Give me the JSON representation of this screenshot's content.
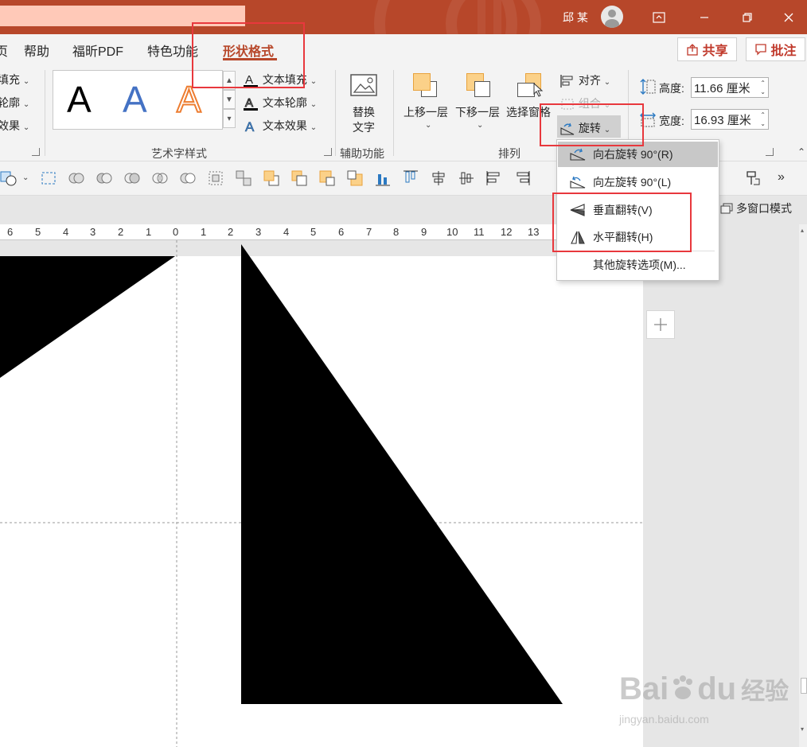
{
  "titlebar": {
    "user_name": "邱 某",
    "buttons": {
      "upload": "⊡",
      "restore": "❐",
      "close": "✕"
    }
  },
  "tabs": [
    {
      "label": "页"
    },
    {
      "label": "帮助"
    },
    {
      "label": "福昕PDF"
    },
    {
      "label": "特色功能"
    },
    {
      "label": "形状格式"
    }
  ],
  "header_buttons": {
    "share": "共享",
    "comment": "批注"
  },
  "ribbon": {
    "shape_styles_left": {
      "fill": "填充",
      "outline": "轮廓",
      "effects": "效果"
    },
    "wordart": {
      "letters": [
        "A",
        "A",
        "A"
      ],
      "text_fill": "文本填充",
      "text_outline": "文本轮廓",
      "text_effects": "文本效果",
      "group_label": "艺术字样式"
    },
    "accessibility": {
      "alt_text_line1": "替换",
      "alt_text_line2": "文字",
      "group_label": "辅助功能"
    },
    "arrange": {
      "bring_forward": "上移一层",
      "send_backward": "下移一层",
      "selection_pane": "选择窗格",
      "align": "对齐",
      "group": "组合",
      "rotate": "旋转",
      "group_label": "排列"
    },
    "size": {
      "height_label": "高度:",
      "height_value": "11.66 厘米",
      "width_label": "宽度:",
      "width_value": "16.93 厘米"
    }
  },
  "multi_window": "多窗口模式",
  "ruler": {
    "labels": [
      "6",
      "5",
      "4",
      "3",
      "2",
      "1",
      "0",
      "1",
      "2",
      "3",
      "4",
      "5",
      "6",
      "7",
      "8",
      "9",
      "10",
      "11",
      "12",
      "13"
    ]
  },
  "rotate_menu": {
    "items": [
      {
        "label": "向右旋转 90°(R)",
        "icon": "rotate-right-icon",
        "highlighted": true
      },
      {
        "label": "向左旋转 90°(L)",
        "icon": "rotate-left-icon",
        "highlighted": false
      },
      {
        "label": "垂直翻转(V)",
        "icon": "flip-vertical-icon",
        "highlighted": false
      },
      {
        "label": "水平翻转(H)",
        "icon": "flip-horizontal-icon",
        "highlighted": false
      },
      {
        "label": "其他旋转选项(M)...",
        "icon": "",
        "highlighted": false
      }
    ]
  },
  "watermark": {
    "brand": "Bai",
    "brand2": "du",
    "cn": "经验",
    "url": "jingyan.baidu.com"
  },
  "colors": {
    "accent": "#b7472a",
    "highlight_box": "#e8383d",
    "menu_highlight": "#c8c8c8"
  }
}
